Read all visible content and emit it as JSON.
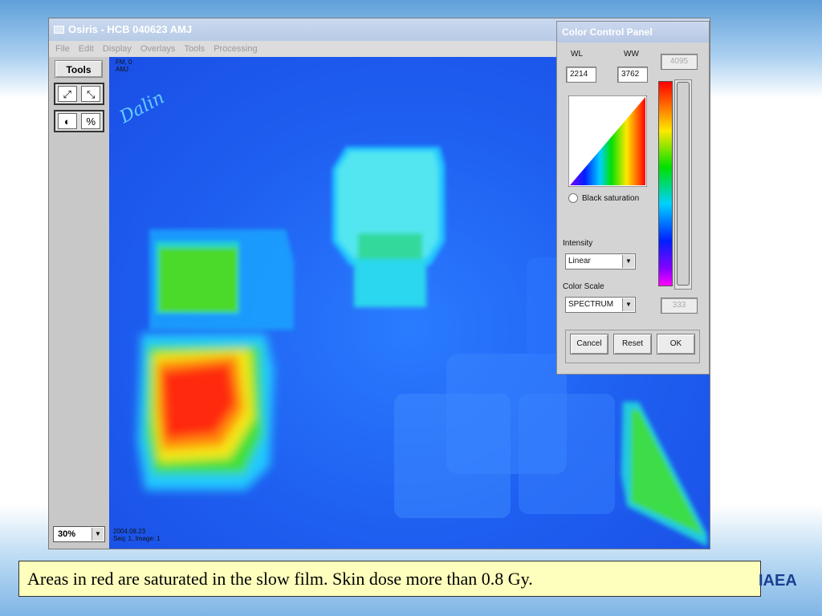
{
  "app": {
    "title": "Osiris - HCB 040623 AMJ",
    "menu": [
      "File",
      "Edit",
      "Display",
      "Overlays",
      "Tools",
      "Processing"
    ],
    "tools_label": "Tools",
    "tool_icons": [
      "zoom-fit-icon",
      "zoom-shrink-icon",
      "contrast-icon",
      "percent-icon"
    ],
    "zoom_value": "30%"
  },
  "image": {
    "top_left_lines": [
      "FM, 0",
      "AMJ"
    ],
    "signature_text": "Dalin",
    "bottom_left_lines": [
      "2004.08.23",
      "Seq: 1, Image: 1"
    ]
  },
  "color_panel": {
    "title": "Color Control Panel",
    "wl_label": "WL",
    "ww_label": "WW",
    "wl_value": "2214",
    "ww_value": "3762",
    "max_value": "4095",
    "min_value": "333",
    "black_saturation_label": "Black saturation",
    "intensity_label": "Intensity",
    "intensity_value": "Linear",
    "color_scale_label": "Color Scale",
    "color_scale_value": "SPECTRUM",
    "cancel_label": "Cancel",
    "reset_label": "Reset",
    "ok_label": "OK"
  },
  "caption": "Areas in red are saturated in the slow film. Skin dose more than 0.8 Gy.",
  "logo_text": "IAEA"
}
